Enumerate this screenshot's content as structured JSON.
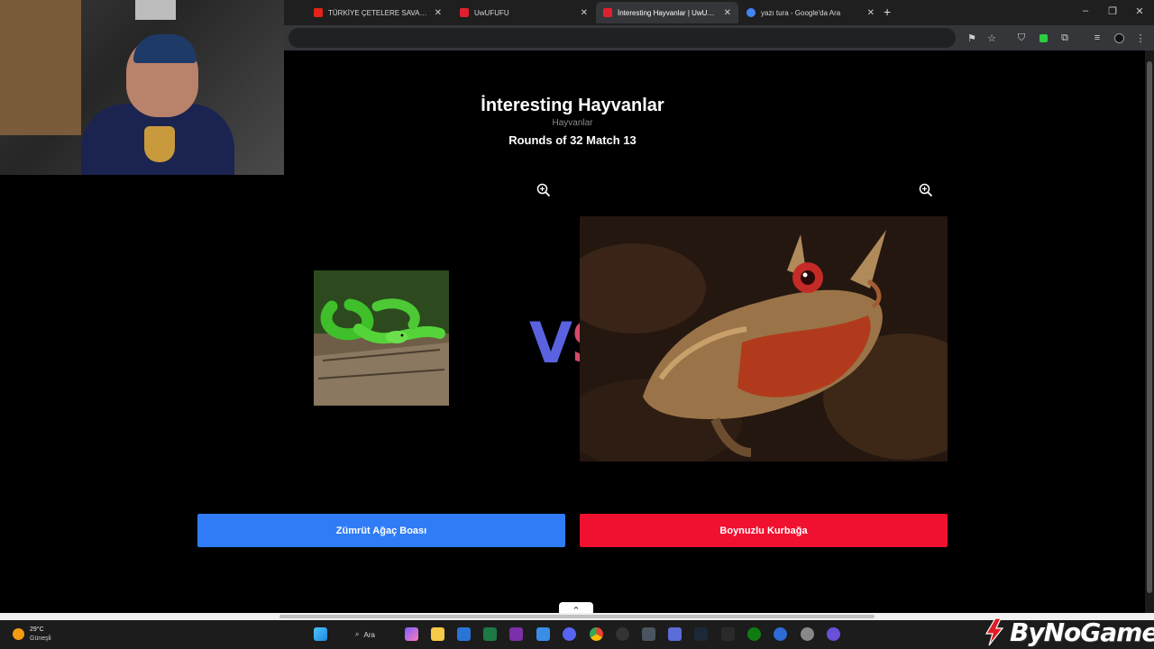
{
  "browser": {
    "tabs": [
      {
        "title": "TÜRKİYE ÇETELERE SAVAŞ AÇTI",
        "favicon_color": "#e62117",
        "active": false
      },
      {
        "title": "UwUFUFU",
        "favicon_color": "#e0202f",
        "active": false
      },
      {
        "title": "İnteresting Hayvanlar | UwUFUFU",
        "favicon_color": "#e0202f",
        "active": true
      },
      {
        "title": "yazı tura - Google'da Ara",
        "favicon_color": "#4285f4",
        "active": false
      }
    ],
    "new_tab_icon": "plus-icon",
    "window_controls": [
      "minimize-icon",
      "restore-icon",
      "close-icon"
    ]
  },
  "game": {
    "title": "İnteresting Hayvanlar",
    "category": "Hayvanlar",
    "round_info": "Rounds of 32 Match 13",
    "vs_text": {
      "v": "V",
      "s": "S"
    },
    "vs_colors": {
      "v": "#5a62e0",
      "s": "#d44a6a"
    },
    "left": {
      "label": "Zümrüt Ağaç Boası",
      "image": "green-snakes-on-log",
      "button_color": "#2f7cf6"
    },
    "right": {
      "label": "Boynuzlu Kurbağa",
      "image": "horned-frog",
      "button_color": "#f0102f"
    },
    "zoom_icon": "zoom-in-icon"
  },
  "taskbar": {
    "weather_temp": "29°C",
    "weather_desc": "Güneşli",
    "search_label": "Ara"
  },
  "overlay": {
    "brand_name": "ByNoGame"
  }
}
